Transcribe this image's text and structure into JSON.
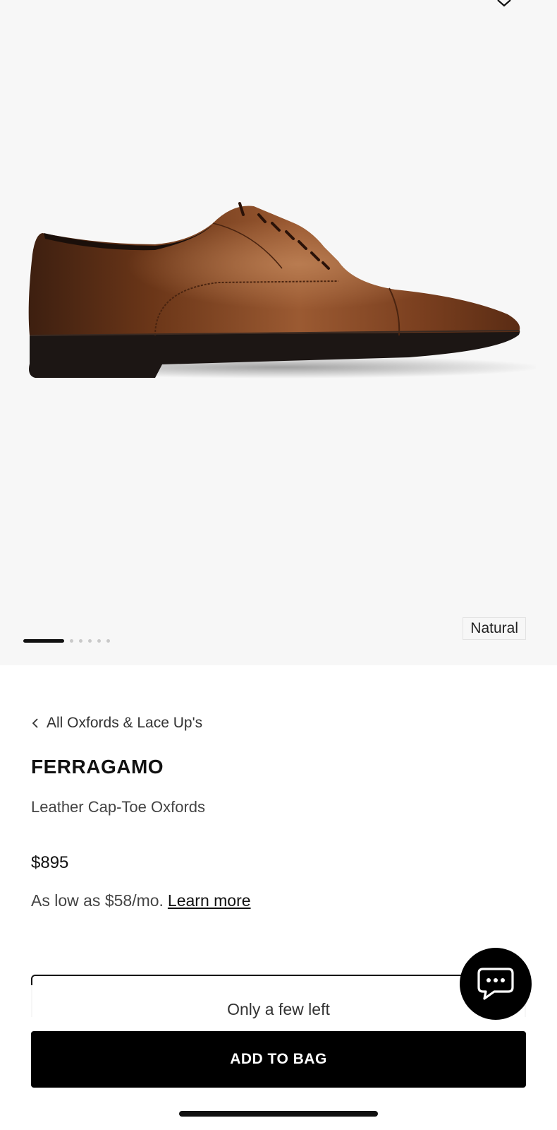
{
  "gallery": {
    "variant_label": "Natural",
    "page_count": 6,
    "active_index": 0
  },
  "breadcrumb": {
    "label": "All Oxfords & Lace Up's"
  },
  "product": {
    "brand": "FERRAGAMO",
    "name": "Leather Cap-Toe Oxfords",
    "price": "$895",
    "financing_text": "As low as $58/mo.",
    "financing_link": "Learn more"
  },
  "purchase": {
    "stock_text": "Only a few left",
    "add_button_label": "ADD TO BAG"
  },
  "icons": {
    "back": "chevron-left-icon",
    "top": "chevron-down-icon",
    "chat": "chat-bubble-icon"
  },
  "colors": {
    "shoe_leather": "#7a3f1f",
    "button_bg": "#000000",
    "gallery_bg": "#f7f7f7"
  }
}
